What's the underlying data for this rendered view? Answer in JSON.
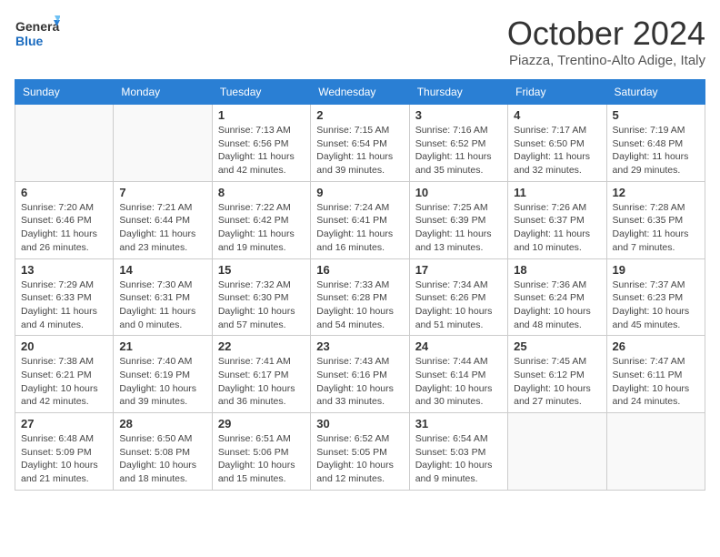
{
  "header": {
    "logo_line1": "General",
    "logo_line2": "Blue",
    "month_title": "October 2024",
    "location": "Piazza, Trentino-Alto Adige, Italy"
  },
  "weekdays": [
    "Sunday",
    "Monday",
    "Tuesday",
    "Wednesday",
    "Thursday",
    "Friday",
    "Saturday"
  ],
  "weeks": [
    [
      {
        "day": "",
        "info": ""
      },
      {
        "day": "",
        "info": ""
      },
      {
        "day": "1",
        "info": "Sunrise: 7:13 AM\nSunset: 6:56 PM\nDaylight: 11 hours and 42 minutes."
      },
      {
        "day": "2",
        "info": "Sunrise: 7:15 AM\nSunset: 6:54 PM\nDaylight: 11 hours and 39 minutes."
      },
      {
        "day": "3",
        "info": "Sunrise: 7:16 AM\nSunset: 6:52 PM\nDaylight: 11 hours and 35 minutes."
      },
      {
        "day": "4",
        "info": "Sunrise: 7:17 AM\nSunset: 6:50 PM\nDaylight: 11 hours and 32 minutes."
      },
      {
        "day": "5",
        "info": "Sunrise: 7:19 AM\nSunset: 6:48 PM\nDaylight: 11 hours and 29 minutes."
      }
    ],
    [
      {
        "day": "6",
        "info": "Sunrise: 7:20 AM\nSunset: 6:46 PM\nDaylight: 11 hours and 26 minutes."
      },
      {
        "day": "7",
        "info": "Sunrise: 7:21 AM\nSunset: 6:44 PM\nDaylight: 11 hours and 23 minutes."
      },
      {
        "day": "8",
        "info": "Sunrise: 7:22 AM\nSunset: 6:42 PM\nDaylight: 11 hours and 19 minutes."
      },
      {
        "day": "9",
        "info": "Sunrise: 7:24 AM\nSunset: 6:41 PM\nDaylight: 11 hours and 16 minutes."
      },
      {
        "day": "10",
        "info": "Sunrise: 7:25 AM\nSunset: 6:39 PM\nDaylight: 11 hours and 13 minutes."
      },
      {
        "day": "11",
        "info": "Sunrise: 7:26 AM\nSunset: 6:37 PM\nDaylight: 11 hours and 10 minutes."
      },
      {
        "day": "12",
        "info": "Sunrise: 7:28 AM\nSunset: 6:35 PM\nDaylight: 11 hours and 7 minutes."
      }
    ],
    [
      {
        "day": "13",
        "info": "Sunrise: 7:29 AM\nSunset: 6:33 PM\nDaylight: 11 hours and 4 minutes."
      },
      {
        "day": "14",
        "info": "Sunrise: 7:30 AM\nSunset: 6:31 PM\nDaylight: 11 hours and 0 minutes."
      },
      {
        "day": "15",
        "info": "Sunrise: 7:32 AM\nSunset: 6:30 PM\nDaylight: 10 hours and 57 minutes."
      },
      {
        "day": "16",
        "info": "Sunrise: 7:33 AM\nSunset: 6:28 PM\nDaylight: 10 hours and 54 minutes."
      },
      {
        "day": "17",
        "info": "Sunrise: 7:34 AM\nSunset: 6:26 PM\nDaylight: 10 hours and 51 minutes."
      },
      {
        "day": "18",
        "info": "Sunrise: 7:36 AM\nSunset: 6:24 PM\nDaylight: 10 hours and 48 minutes."
      },
      {
        "day": "19",
        "info": "Sunrise: 7:37 AM\nSunset: 6:23 PM\nDaylight: 10 hours and 45 minutes."
      }
    ],
    [
      {
        "day": "20",
        "info": "Sunrise: 7:38 AM\nSunset: 6:21 PM\nDaylight: 10 hours and 42 minutes."
      },
      {
        "day": "21",
        "info": "Sunrise: 7:40 AM\nSunset: 6:19 PM\nDaylight: 10 hours and 39 minutes."
      },
      {
        "day": "22",
        "info": "Sunrise: 7:41 AM\nSunset: 6:17 PM\nDaylight: 10 hours and 36 minutes."
      },
      {
        "day": "23",
        "info": "Sunrise: 7:43 AM\nSunset: 6:16 PM\nDaylight: 10 hours and 33 minutes."
      },
      {
        "day": "24",
        "info": "Sunrise: 7:44 AM\nSunset: 6:14 PM\nDaylight: 10 hours and 30 minutes."
      },
      {
        "day": "25",
        "info": "Sunrise: 7:45 AM\nSunset: 6:12 PM\nDaylight: 10 hours and 27 minutes."
      },
      {
        "day": "26",
        "info": "Sunrise: 7:47 AM\nSunset: 6:11 PM\nDaylight: 10 hours and 24 minutes."
      }
    ],
    [
      {
        "day": "27",
        "info": "Sunrise: 6:48 AM\nSunset: 5:09 PM\nDaylight: 10 hours and 21 minutes."
      },
      {
        "day": "28",
        "info": "Sunrise: 6:50 AM\nSunset: 5:08 PM\nDaylight: 10 hours and 18 minutes."
      },
      {
        "day": "29",
        "info": "Sunrise: 6:51 AM\nSunset: 5:06 PM\nDaylight: 10 hours and 15 minutes."
      },
      {
        "day": "30",
        "info": "Sunrise: 6:52 AM\nSunset: 5:05 PM\nDaylight: 10 hours and 12 minutes."
      },
      {
        "day": "31",
        "info": "Sunrise: 6:54 AM\nSunset: 5:03 PM\nDaylight: 10 hours and 9 minutes."
      },
      {
        "day": "",
        "info": ""
      },
      {
        "day": "",
        "info": ""
      }
    ]
  ]
}
